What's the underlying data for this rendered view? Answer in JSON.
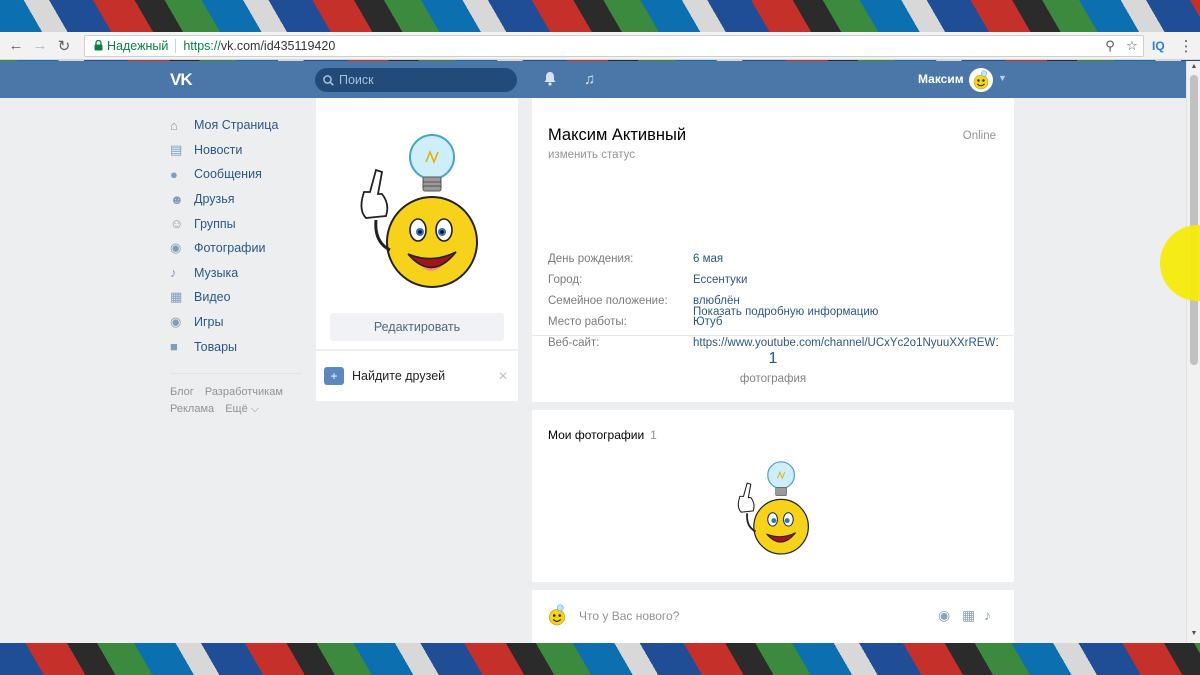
{
  "browser": {
    "secure_label": "Надежный",
    "url_proto": "https://",
    "url_rest": "vk.com/id435119420",
    "ext_label": "IQ"
  },
  "header": {
    "logo": "VK",
    "search_placeholder": "Поиск",
    "user_name": "Максим"
  },
  "left_menu": {
    "items": [
      {
        "label": "Моя Страница",
        "icon": "home-icon"
      },
      {
        "label": "Новости",
        "icon": "news-icon"
      },
      {
        "label": "Сообщения",
        "icon": "messages-icon"
      },
      {
        "label": "Друзья",
        "icon": "friends-icon"
      },
      {
        "label": "Группы",
        "icon": "groups-icon"
      },
      {
        "label": "Фотографии",
        "icon": "camera-icon"
      },
      {
        "label": "Музыка",
        "icon": "music-note-icon"
      },
      {
        "label": "Видео",
        "icon": "film-icon"
      },
      {
        "label": "Игры",
        "icon": "gamepad-icon"
      },
      {
        "label": "Товары",
        "icon": "bag-icon"
      }
    ],
    "footer": [
      "Блог",
      "Разработчикам",
      "Реклама",
      "Ещё ⌵"
    ]
  },
  "avatar_card": {
    "edit_label": "Редактировать",
    "find_friends_label": "Найдите друзей"
  },
  "profile": {
    "name": "Максим Активный",
    "status": "изменить статус",
    "online": "Online",
    "fields": [
      {
        "label": "День рождения:",
        "value": "6 мая"
      },
      {
        "label": "Город:",
        "value": "Ессентуки"
      },
      {
        "label": "Семейное положение:",
        "value": "влюблён"
      },
      {
        "label": "Место работы:",
        "value": "Ютуб"
      },
      {
        "label": "Веб-сайт:",
        "value": "https://www.youtube.com/channel/UCxYc2o1NyuuXXrREW1"
      }
    ],
    "more_info": "Показать подробную информацию",
    "photo_count": "1",
    "photo_count_label": "фотография"
  },
  "photos": {
    "title": "Мои фотографии",
    "count": "1"
  },
  "post": {
    "placeholder": "Что у Вас нового?"
  },
  "colors": {
    "vk_blue": "#4a76a8",
    "link": "#2a5885",
    "bg": "#edeef0"
  }
}
